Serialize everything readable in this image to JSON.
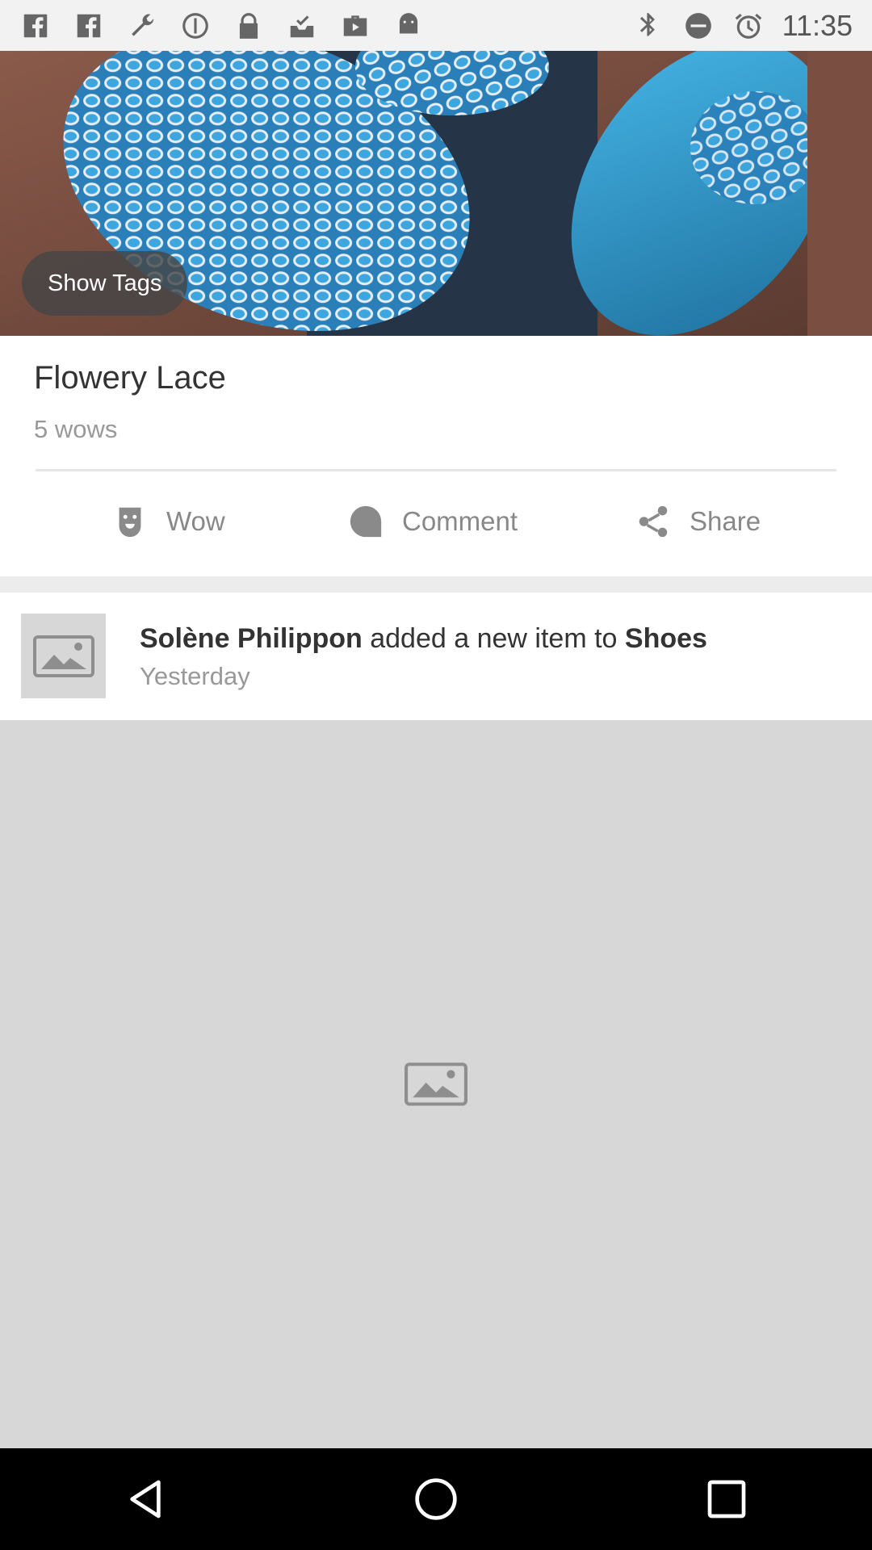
{
  "status_bar": {
    "time": "11:35",
    "left_icons": [
      "facebook-icon",
      "facebook-icon",
      "wrench-icon",
      "circle-icon",
      "lock-icon",
      "inbox-check-icon",
      "briefcase-icon",
      "android-icon"
    ],
    "right_icons": [
      "bluetooth-icon",
      "do-not-disturb-icon",
      "alarm-icon"
    ]
  },
  "post": {
    "show_tags_label": "Show Tags",
    "title": "Flowery Lace",
    "wows_text": "5 wows",
    "actions": {
      "wow_label": "Wow",
      "comment_label": "Comment",
      "share_label": "Share"
    }
  },
  "feed_item": {
    "user_name": "Solène Philippon",
    "action_text": " added a new item to ",
    "target": "Shoes",
    "time": "Yesterday"
  },
  "colors": {
    "accent_icon": "#8a8a8a",
    "placeholder_bg": "#d7d7d7",
    "nav_bg": "#000000"
  }
}
